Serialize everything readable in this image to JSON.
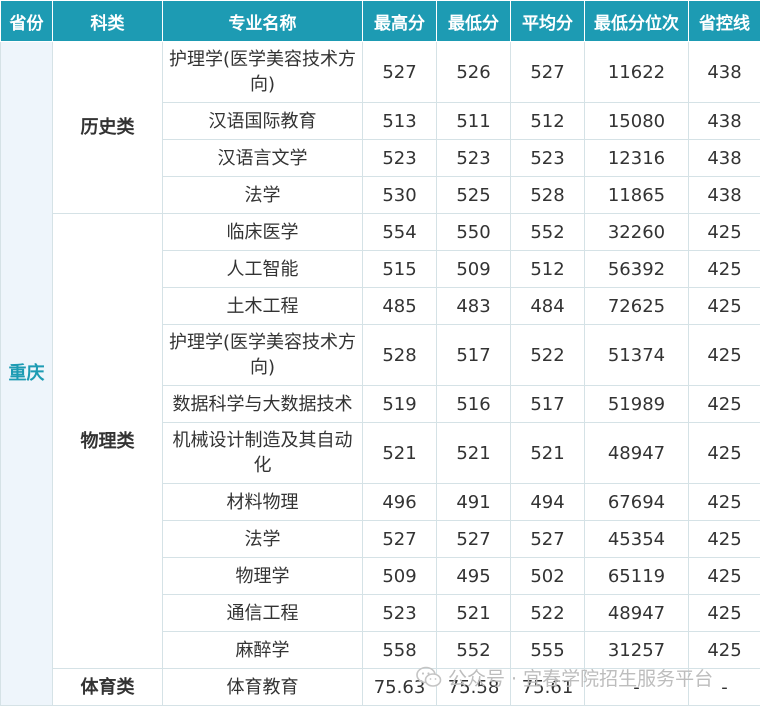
{
  "headers": [
    "省份",
    "科类",
    "专业名称",
    "最高分",
    "最低分",
    "平均分",
    "最低分位次",
    "省控线"
  ],
  "province": "重庆",
  "categories": [
    "历史类",
    "物理类",
    "体育类"
  ],
  "rows": [
    {
      "major": "护理学(医学美容技术方向)",
      "max": "527",
      "min": "526",
      "avg": "527",
      "rank": "11622",
      "line": "438"
    },
    {
      "major": "汉语国际教育",
      "max": "513",
      "min": "511",
      "avg": "512",
      "rank": "15080",
      "line": "438"
    },
    {
      "major": "汉语言文学",
      "max": "523",
      "min": "523",
      "avg": "523",
      "rank": "12316",
      "line": "438"
    },
    {
      "major": "法学",
      "max": "530",
      "min": "525",
      "avg": "528",
      "rank": "11865",
      "line": "438"
    },
    {
      "major": "临床医学",
      "max": "554",
      "min": "550",
      "avg": "552",
      "rank": "32260",
      "line": "425"
    },
    {
      "major": "人工智能",
      "max": "515",
      "min": "509",
      "avg": "512",
      "rank": "56392",
      "line": "425"
    },
    {
      "major": "土木工程",
      "max": "485",
      "min": "483",
      "avg": "484",
      "rank": "72625",
      "line": "425"
    },
    {
      "major": "护理学(医学美容技术方向)",
      "max": "528",
      "min": "517",
      "avg": "522",
      "rank": "51374",
      "line": "425"
    },
    {
      "major": "数据科学与大数据技术",
      "max": "519",
      "min": "516",
      "avg": "517",
      "rank": "51989",
      "line": "425"
    },
    {
      "major": "机械设计制造及其自动化",
      "max": "521",
      "min": "521",
      "avg": "521",
      "rank": "48947",
      "line": "425"
    },
    {
      "major": "材料物理",
      "max": "496",
      "min": "491",
      "avg": "494",
      "rank": "67694",
      "line": "425"
    },
    {
      "major": "法学",
      "max": "527",
      "min": "527",
      "avg": "527",
      "rank": "45354",
      "line": "425"
    },
    {
      "major": "物理学",
      "max": "509",
      "min": "495",
      "avg": "502",
      "rank": "65119",
      "line": "425"
    },
    {
      "major": "通信工程",
      "max": "523",
      "min": "521",
      "avg": "522",
      "rank": "48947",
      "line": "425"
    },
    {
      "major": "麻醉学",
      "max": "558",
      "min": "552",
      "avg": "555",
      "rank": "31257",
      "line": "425"
    },
    {
      "major": "体育教育",
      "max": "75.63",
      "min": "75.58",
      "avg": "75.61",
      "rank": "-",
      "line": "-"
    }
  ],
  "watermark": {
    "icon": "wechat-icon",
    "text": "公众号 · 宜春学院招生服务平台"
  }
}
